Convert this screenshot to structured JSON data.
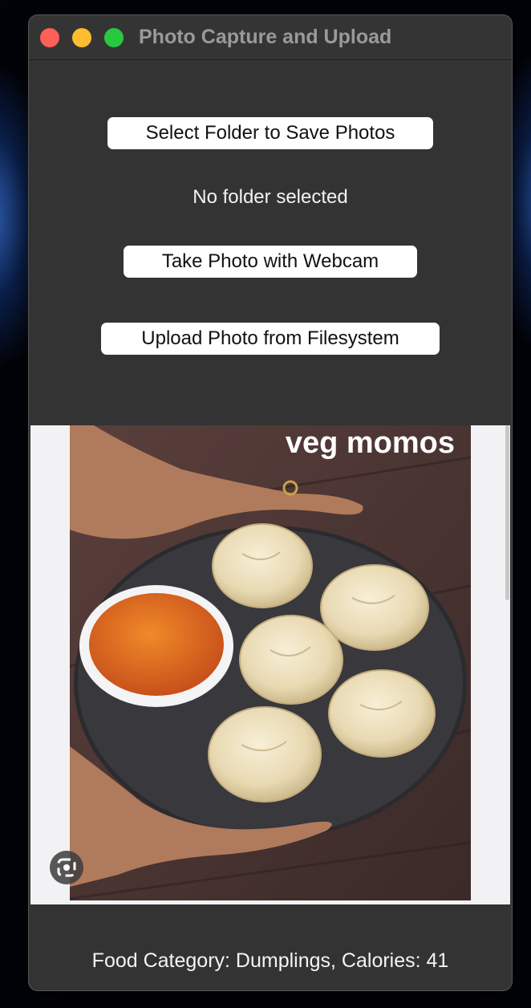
{
  "window": {
    "title": "Photo Capture and Upload"
  },
  "buttons": {
    "select_folder": "Select Folder to Save Photos",
    "take_photo": "Take Photo with Webcam",
    "upload_photo": "Upload Photo from Filesystem"
  },
  "status": {
    "folder_label": "No folder selected"
  },
  "image": {
    "overlay_text": "veg momos",
    "lens_icon": "google-lens-icon"
  },
  "result": {
    "text": "Food Category: Dumplings, Calories: 41"
  },
  "colors": {
    "close": "#fe5f57",
    "minimize": "#febc2e",
    "maximize": "#28c840",
    "window_bg": "#333333"
  }
}
